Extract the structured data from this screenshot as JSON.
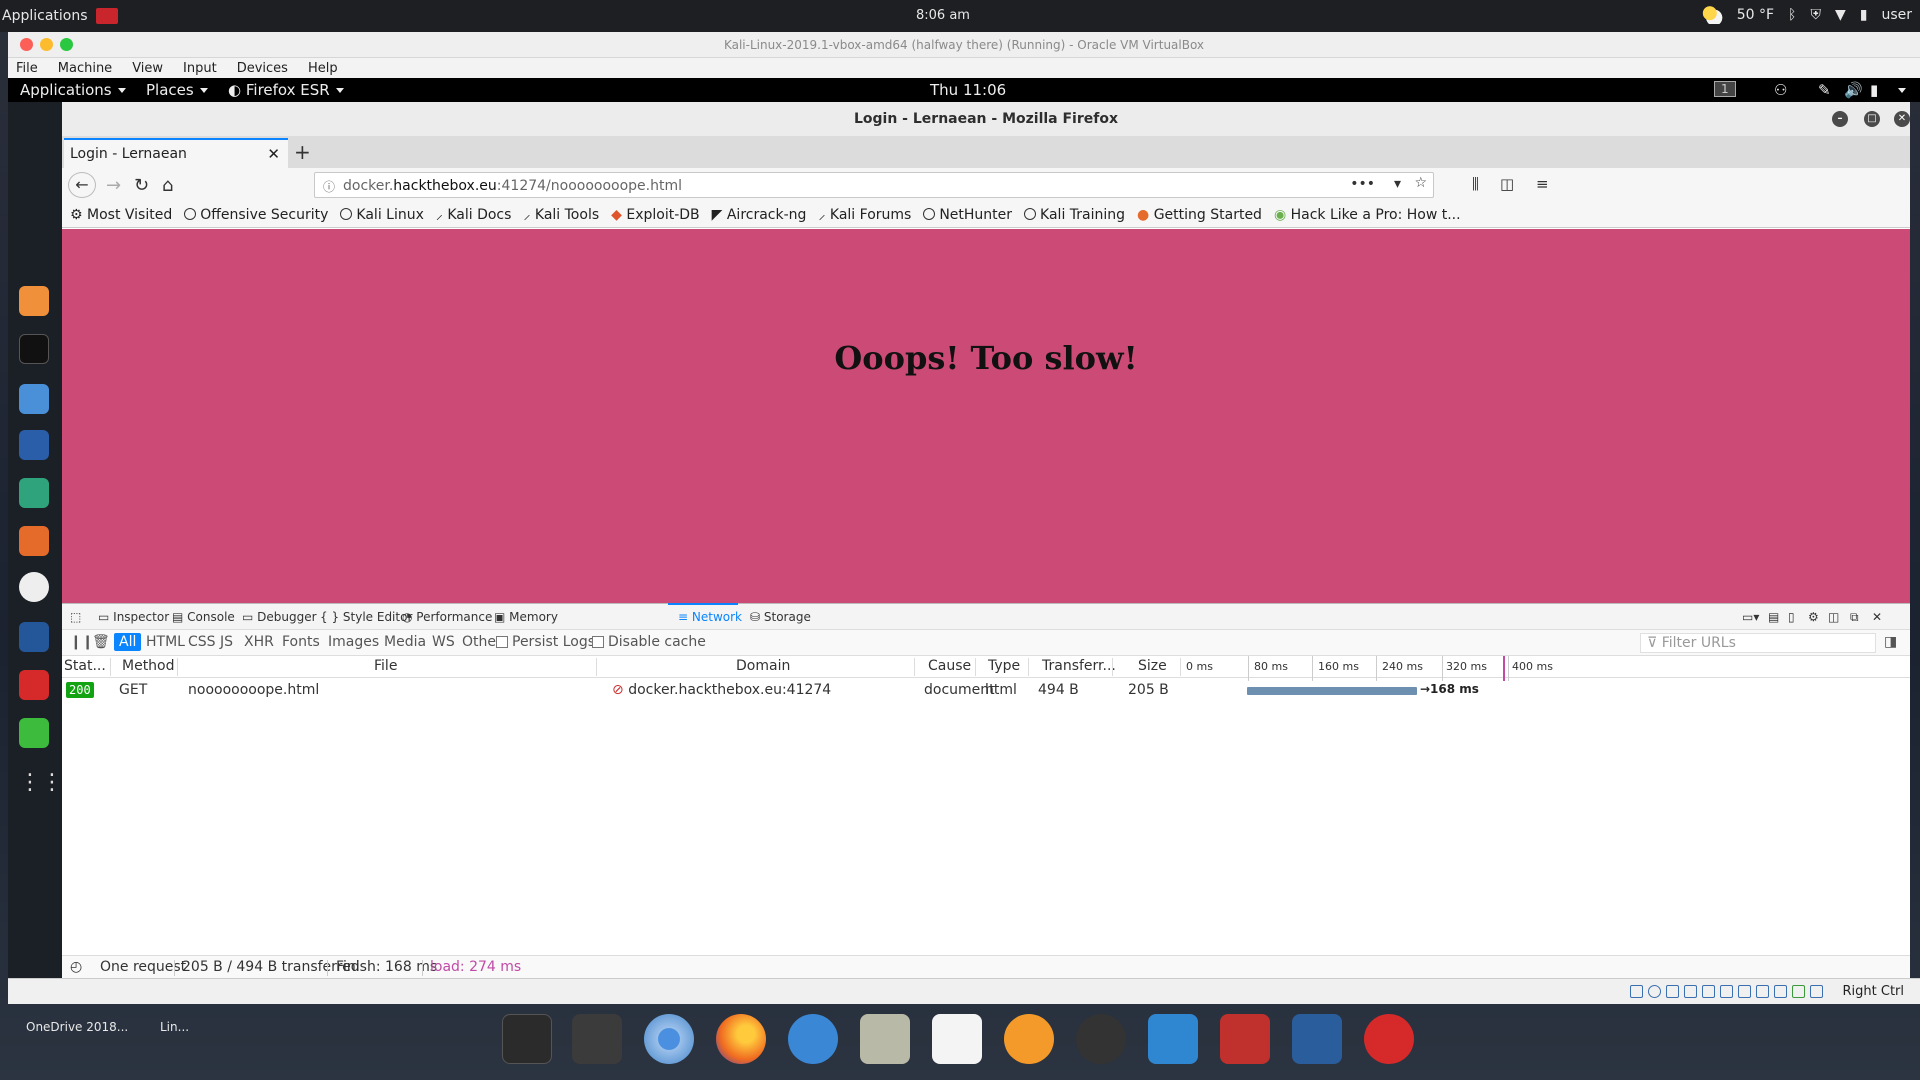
{
  "host": {
    "applications_label": "Applications",
    "clock": "8:06 am",
    "weather": "50 °F",
    "user": "user"
  },
  "vbox": {
    "title": "Kali-Linux-2019.1-vbox-amd64 (halfway there) (Running) - Oracle VM VirtualBox",
    "menu": [
      "File",
      "Machine",
      "View",
      "Input",
      "Devices",
      "Help"
    ],
    "host_key_label": "Right Ctrl"
  },
  "kali": {
    "applications": "Applications",
    "places": "Places",
    "browser": "Firefox ESR",
    "clock": "Thu 11:06",
    "workspace": "1"
  },
  "firefox": {
    "window_title": "Login - Lernaean - Mozilla Firefox",
    "tab_title": "Login - Lernaean",
    "url_prefix": "docker.",
    "url_host": "hackthebox.eu",
    "url_suffix": ":41274/noooooooope.html",
    "bookmarks": [
      "Most Visited",
      "Offensive Security",
      "Kali Linux",
      "Kali Docs",
      "Kali Tools",
      "Exploit-DB",
      "Aircrack-ng",
      "Kali Forums",
      "NetHunter",
      "Kali Training",
      "Getting Started",
      "Hack Like a Pro: How t..."
    ]
  },
  "page": {
    "heading": "Ooops! Too slow!",
    "background": "#cc4b76"
  },
  "devtools": {
    "tabs": [
      "Inspector",
      "Console",
      "Debugger",
      "Style Editor",
      "Performance",
      "Memory",
      "Network",
      "Storage"
    ],
    "selected_tab": "Network",
    "filters": [
      "All",
      "HTML",
      "CSS",
      "JS",
      "XHR",
      "Fonts",
      "Images",
      "Media",
      "WS",
      "Other"
    ],
    "persist_logs": "Persist Logs",
    "disable_cache": "Disable cache",
    "filter_placeholder": "Filter URLs",
    "columns": [
      "Stat...",
      "Method",
      "File",
      "Domain",
      "Cause",
      "Type",
      "Transferr...",
      "Size"
    ],
    "timeline_ticks": [
      "0 ms",
      "80 ms",
      "160 ms",
      "240 ms",
      "320 ms",
      "400 ms"
    ],
    "row": {
      "status": "200",
      "method": "GET",
      "file": "noooooooope.html",
      "domain": "docker.hackthebox.eu:41274",
      "cause": "document",
      "type": "html",
      "transferred": "494 B",
      "size": "205 B",
      "timing": "→168 ms"
    },
    "summary": {
      "requests": "One request",
      "transferred": "205 B / 494 B transferred",
      "finish": "Finish: 168 ms",
      "load": "load: 274 ms"
    }
  },
  "desktop": {
    "item1": "OneDrive 2018...",
    "item2": "Lin..."
  },
  "colors": {
    "accent": "#0a84ff",
    "status_ok": "#12a312",
    "load_marker": "#c04aa6"
  }
}
